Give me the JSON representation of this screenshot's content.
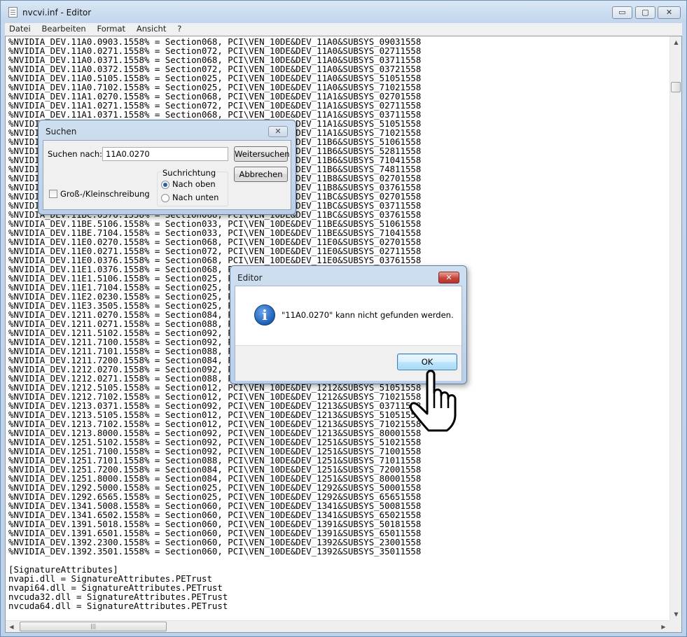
{
  "window": {
    "title": "nvcvi.inf - Editor",
    "minimize_glyph": "▭",
    "maximize_glyph": "▢",
    "close_glyph": "✕"
  },
  "menu": [
    "Datei",
    "Bearbeiten",
    "Format",
    "Ansicht",
    "?"
  ],
  "editor": {
    "lines": [
      "%NVIDIA_DEV.11A0.0903.1558% = Section068, PCI\\VEN_10DE&DEV_11A0&SUBSYS_09031558",
      "%NVIDIA_DEV.11A0.0271.1558% = Section072, PCI\\VEN_10DE&DEV_11A0&SUBSYS_02711558",
      "%NVIDIA_DEV.11A0.0371.1558% = Section068, PCI\\VEN_10DE&DEV_11A0&SUBSYS_03711558",
      "%NVIDIA_DEV.11A0.0372.1558% = Section072, PCI\\VEN_10DE&DEV_11A0&SUBSYS_03721558",
      "%NVIDIA_DEV.11A0.5105.1558% = Section025, PCI\\VEN_10DE&DEV_11A0&SUBSYS_51051558",
      "%NVIDIA_DEV.11A0.7102.1558% = Section025, PCI\\VEN_10DE&DEV_11A0&SUBSYS_71021558",
      "%NVIDIA_DEV.11A1.0270.1558% = Section068, PCI\\VEN_10DE&DEV_11A1&SUBSYS_02701558",
      "%NVIDIA_DEV.11A1.0271.1558% = Section072, PCI\\VEN_10DE&DEV_11A1&SUBSYS_02711558",
      "%NVIDIA_DEV.11A1.0371.1558% = Section068, PCI\\VEN_10DE&DEV_11A1&SUBSYS_03711558",
      "%NVIDIA_DEV.11A1.5105.1558% = Section025, PCI\\VEN_10DE&DEV_11A1&SUBSYS_51051558",
      "%NVIDIA_DEV.11A1.7102.1558% = Section025, PCI\\VEN_10DE&DEV_11A1&SUBSYS_71021558",
      "%NVIDIA_DEV.11B6.5106.1558% = Section033, PCI\\VEN_10DE&DEV_11B6&SUBSYS_51061558",
      "%NVIDIA_DEV.11B6.5281.1558% = Section033, PCI\\VEN_10DE&DEV_11B6&SUBSYS_52811558",
      "%NVIDIA_DEV.11B6.7104.1558% = Section033, PCI\\VEN_10DE&DEV_11B6&SUBSYS_71041558",
      "%NVIDIA_DEV.11B6.7481.1558% = Section033, PCI\\VEN_10DE&DEV_11B6&SUBSYS_74811558",
      "%NVIDIA_DEV.11B8.0270.1558% = Section068, PCI\\VEN_10DE&DEV_11B8&SUBSYS_02701558",
      "%NVIDIA_DEV.11B8.0376.1558% = Section068, PCI\\VEN_10DE&DEV_11B8&SUBSYS_03761558",
      "%NVIDIA_DEV.11BC.0270.1558% = Section068, PCI\\VEN_10DE&DEV_11BC&SUBSYS_02701558",
      "%NVIDIA_DEV.11BC.0371.1558% = Section068, PCI\\VEN_10DE&DEV_11BC&SUBSYS_03711558",
      "%NVIDIA_DEV.11BC.0376.1558% = Section068, PCI\\VEN_10DE&DEV_11BC&SUBSYS_03761558",
      "%NVIDIA_DEV.11BE.5106.1558% = Section033, PCI\\VEN_10DE&DEV_11BE&SUBSYS_51061558",
      "%NVIDIA_DEV.11BE.7104.1558% = Section033, PCI\\VEN_10DE&DEV_11BE&SUBSYS_71041558",
      "%NVIDIA_DEV.11E0.0270.1558% = Section068, PCI\\VEN_10DE&DEV_11E0&SUBSYS_02701558",
      "%NVIDIA_DEV.11E0.0271.1558% = Section072, PCI\\VEN_10DE&DEV_11E0&SUBSYS_02711558",
      "%NVIDIA_DEV.11E0.0376.1558% = Section068, PCI\\VEN_10DE&DEV_11E0&SUBSYS_03761558",
      "%NVIDIA_DEV.11E1.0376.1558% = Section068, PCI\\VEN_10DE&DEV_11E1&SUBSYS_03761558",
      "%NVIDIA_DEV.11E1.5106.1558% = Section025, PCI\\VEN_10DE&DEV_11E1&SUBSYS_51061558",
      "%NVIDIA_DEV.11E1.7104.1558% = Section025, PCI\\VEN_10DE&DEV_11E1&SUBSYS_71041558",
      "%NVIDIA_DEV.11E2.0230.1558% = Section025, PCI\\VEN_10DE&DEV_11E2&SUBSYS_02301558",
      "%NVIDIA_DEV.11E3.3505.1558% = Section025, PCI\\VEN_10DE&DEV_11E3&SUBSYS_35051558",
      "%NVIDIA_DEV.1211.0270.1558% = Section084, PCI\\VEN_10DE&DEV_1211&SUBSYS_02701558",
      "%NVIDIA_DEV.1211.0271.1558% = Section088, PCI\\VEN_10DE&DEV_1211&SUBSYS_02711558",
      "%NVIDIA_DEV.1211.5102.1558% = Section092, PCI\\VEN_10DE&DEV_1211&SUBSYS_51021558",
      "%NVIDIA_DEV.1211.7100.1558% = Section092, PCI\\VEN_10DE&DEV_1211&SUBSYS_71001558",
      "%NVIDIA_DEV.1211.7101.1558% = Section088, PCI\\VEN_10DE&DEV_1211&SUBSYS_71011558",
      "%NVIDIA_DEV.1211.7200.1558% = Section084, PCI\\VEN_10DE&DEV_1211&SUBSYS_72001558",
      "%NVIDIA_DEV.1212.0270.1558% = Section092, PCI\\VEN_10DE&DEV_1212&SUBSYS_02701558",
      "%NVIDIA_DEV.1212.0271.1558% = Section088, PCI\\VEN_10DE&DEV_1212&SUBSYS_02711558",
      "%NVIDIA_DEV.1212.5105.1558% = Section012, PCI\\VEN_10DE&DEV_1212&SUBSYS_51051558",
      "%NVIDIA_DEV.1212.7102.1558% = Section012, PCI\\VEN_10DE&DEV_1212&SUBSYS_71021558",
      "%NVIDIA_DEV.1213.0371.1558% = Section092, PCI\\VEN_10DE&DEV_1213&SUBSYS_03711558",
      "%NVIDIA_DEV.1213.5105.1558% = Section012, PCI\\VEN_10DE&DEV_1213&SUBSYS_51051558",
      "%NVIDIA_DEV.1213.7102.1558% = Section012, PCI\\VEN_10DE&DEV_1213&SUBSYS_71021558",
      "%NVIDIA_DEV.1213.8000.1558% = Section092, PCI\\VEN_10DE&DEV_1213&SUBSYS_80001558",
      "%NVIDIA_DEV.1251.5102.1558% = Section092, PCI\\VEN_10DE&DEV_1251&SUBSYS_51021558",
      "%NVIDIA_DEV.1251.7100.1558% = Section092, PCI\\VEN_10DE&DEV_1251&SUBSYS_71001558",
      "%NVIDIA_DEV.1251.7101.1558% = Section088, PCI\\VEN_10DE&DEV_1251&SUBSYS_71011558",
      "%NVIDIA_DEV.1251.7200.1558% = Section084, PCI\\VEN_10DE&DEV_1251&SUBSYS_72001558",
      "%NVIDIA_DEV.1251.8000.1558% = Section084, PCI\\VEN_10DE&DEV_1251&SUBSYS_80001558",
      "%NVIDIA_DEV.1292.5000.1558% = Section025, PCI\\VEN_10DE&DEV_1292&SUBSYS_50001558",
      "%NVIDIA_DEV.1292.6565.1558% = Section025, PCI\\VEN_10DE&DEV_1292&SUBSYS_65651558",
      "%NVIDIA_DEV.1341.5008.1558% = Section060, PCI\\VEN_10DE&DEV_1341&SUBSYS_50081558",
      "%NVIDIA_DEV.1341.6502.1558% = Section060, PCI\\VEN_10DE&DEV_1341&SUBSYS_65021558",
      "%NVIDIA_DEV.1391.5018.1558% = Section060, PCI\\VEN_10DE&DEV_1391&SUBSYS_50181558",
      "%NVIDIA_DEV.1391.6501.1558% = Section060, PCI\\VEN_10DE&DEV_1391&SUBSYS_65011558",
      "%NVIDIA_DEV.1392.2300.1558% = Section060, PCI\\VEN_10DE&DEV_1392&SUBSYS_23001558",
      "%NVIDIA_DEV.1392.3501.1558% = Section060, PCI\\VEN_10DE&DEV_1392&SUBSYS_35011558",
      "",
      "[SignatureAttributes]",
      "nvapi.dll = SignatureAttributes.PETrust",
      "nvapi64.dll = SignatureAttributes.PETrust",
      "nvcuda32.dll = SignatureAttributes.PETrust",
      "nvcuda64.dll = SignatureAttributes.PETrust"
    ]
  },
  "find_dialog": {
    "title": "Suchen",
    "close_glyph": "✕",
    "search_label": "Suchen nach:",
    "search_value": "11A0.0270",
    "find_next_label": "Weitersuchen",
    "cancel_label": "Abbrechen",
    "direction_label": "Suchrichtung",
    "up_label": "Nach oben",
    "down_label": "Nach unten",
    "match_case_label": "Groß-/Kleinschreibung",
    "direction_selected": "Nach oben",
    "match_case_checked": false
  },
  "message_box": {
    "title": "Editor",
    "close_glyph": "✕",
    "info_glyph": "i",
    "message": "\"11A0.0270\" kann nicht gefunden werden.",
    "ok_label": "OK"
  },
  "colors": {
    "close_red": "#c8453b",
    "info_blue": "#1c5fb4",
    "ok_focus": "#3c7fb1"
  }
}
